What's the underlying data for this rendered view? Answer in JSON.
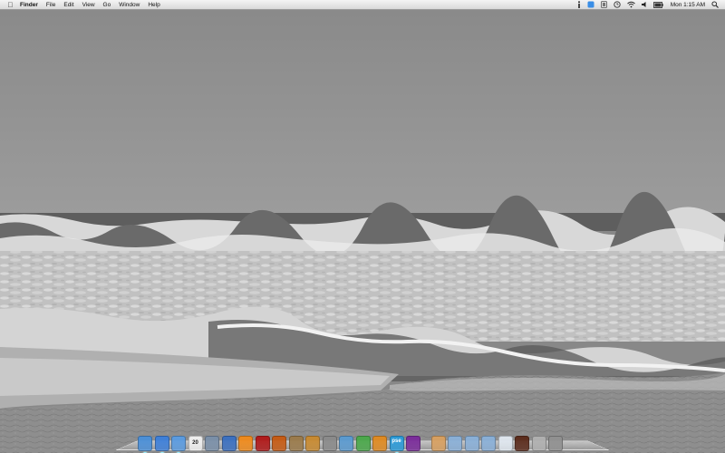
{
  "menubar": {
    "apple_icon": "apple-logo-icon",
    "app_name": "Finder",
    "menus": [
      "File",
      "Edit",
      "View",
      "Go",
      "Window",
      "Help"
    ],
    "status_icons": [
      "info-icon",
      "dropbox-icon",
      "battery-monitor-icon",
      "time-machine-icon",
      "wifi-icon",
      "volume-icon",
      "battery-icon"
    ],
    "clock": "Mon 1:15 AM",
    "spotlight_icon": "spotlight-search-icon"
  },
  "desktop": {
    "wallpaper": "grayscale ocean waves on beach"
  },
  "dock": {
    "items": [
      {
        "name": "finder",
        "color": "#4a8fd8"
      },
      {
        "name": "safari",
        "color": "#3d7fd9"
      },
      {
        "name": "ichat",
        "color": "#5a9be0"
      },
      {
        "name": "ical",
        "color": "#f0f0f0",
        "text": "20"
      },
      {
        "name": "iphoto",
        "color": "#7a8fa8"
      },
      {
        "name": "itunes",
        "color": "#3a6fc0"
      },
      {
        "name": "vlc",
        "color": "#f08a1a"
      },
      {
        "name": "photo-booth",
        "color": "#b01818"
      },
      {
        "name": "photoshop-elements",
        "color": "#c65a12"
      },
      {
        "name": "preview",
        "color": "#9a7a4a"
      },
      {
        "name": "garageband",
        "color": "#c88a30"
      },
      {
        "name": "system-preferences",
        "color": "#8a8a8a"
      },
      {
        "name": "mail",
        "color": "#5a9ad0"
      },
      {
        "name": "dashcode",
        "color": "#4aa84a"
      },
      {
        "name": "textwrangler",
        "color": "#e08a20"
      },
      {
        "name": "pse",
        "color": "#2a9ad8",
        "text": "pse"
      },
      {
        "name": "dvd-player",
        "color": "#7a2a9a"
      },
      {
        "name": "home-folder",
        "color": "#d8a060"
      },
      {
        "name": "applications-folder",
        "color": "#8ab0d8"
      },
      {
        "name": "documents-folder",
        "color": "#8ab0d8"
      },
      {
        "name": "downloads-folder",
        "color": "#8ab0d8"
      },
      {
        "name": "stack-document",
        "color": "#e0e8f0"
      },
      {
        "name": "stack-image",
        "color": "#5a2a1a"
      },
      {
        "name": "stack-misc",
        "color": "#b0b0b0"
      },
      {
        "name": "trash",
        "color": "#909090"
      }
    ]
  }
}
